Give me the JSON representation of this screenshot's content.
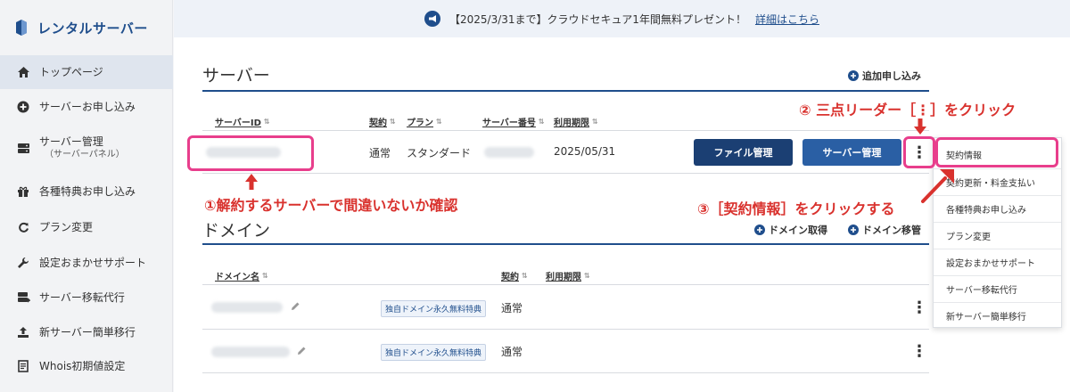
{
  "sidebar": {
    "brand": "レンタルサーバー",
    "items": [
      {
        "label": "トップページ",
        "icon": "home-icon"
      },
      {
        "label": "サーバーお申し込み",
        "icon": "plus-circle-icon"
      },
      {
        "label": "サーバー管理",
        "sub": "（サーバーパネル）",
        "icon": "server-icon"
      },
      {
        "label": "各種特典お申し込み",
        "icon": "gift-icon"
      },
      {
        "label": "プラン変更",
        "icon": "refresh-icon"
      },
      {
        "label": "設定おまかせサポート",
        "icon": "wrench-icon"
      },
      {
        "label": "サーバー移転代行",
        "icon": "server-move-icon"
      },
      {
        "label": "新サーバー簡単移行",
        "icon": "upload-icon"
      },
      {
        "label": "Whois初期値設定",
        "icon": "document-icon"
      }
    ]
  },
  "banner": {
    "text": "【2025/3/31まで】クラウドセキュア1年間無料プレゼント！",
    "link": "詳細はこちら"
  },
  "server": {
    "title": "サーバー",
    "add_action": "追加申し込み",
    "columns": [
      "サーバーID",
      "契約",
      "プラン",
      "サーバー番号",
      "利用期限"
    ],
    "row": {
      "contract": "通常",
      "plan": "スタンダード",
      "expiry": "2025/05/31",
      "file_btn": "ファイル管理",
      "server_btn": "サーバー管理"
    }
  },
  "domain": {
    "title": "ドメイン",
    "get_action": "ドメイン取得",
    "transfer_action": "ドメイン移管",
    "columns": [
      "ドメイン名",
      "契約",
      "利用期限"
    ],
    "rows": [
      {
        "tag": "独自ドメイン永久無料特典",
        "contract": "通常"
      },
      {
        "tag": "独自ドメイン永久無料特典",
        "contract": "通常"
      }
    ]
  },
  "dropdown": {
    "items": [
      "契約情報",
      "契約更新・料金支払い",
      "各種特典お申し込み",
      "プラン変更",
      "設定おまかせサポート",
      "サーバー移転代行",
      "新サーバー簡単移行"
    ]
  },
  "annotations": {
    "step1": "①解約するサーバーで間違いないか確認",
    "step2": "② 三点リーダー［⋮］をクリック",
    "step3": "③［契約情報］をクリックする"
  },
  "colors": {
    "brand": "#1f4e8c",
    "highlight": "#e83e8c",
    "annotation": "#d9322e"
  }
}
